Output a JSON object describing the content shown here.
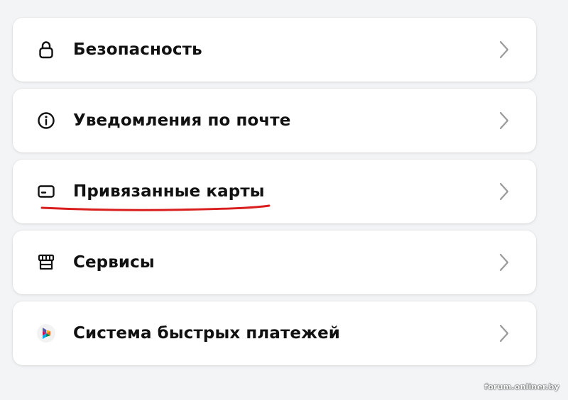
{
  "menu": {
    "items": [
      {
        "label": "Безопасность",
        "icon": "lock-icon"
      },
      {
        "label": "Уведомления по почте",
        "icon": "info-icon"
      },
      {
        "label": "Привязанные карты",
        "icon": "card-icon"
      },
      {
        "label": "Сервисы",
        "icon": "store-icon"
      },
      {
        "label": "Система быстрых платежей",
        "icon": "sbp-logo-icon"
      }
    ]
  },
  "annotation": {
    "underline_color": "#d91c1c"
  },
  "watermark": {
    "text": "forum.onliner.by"
  },
  "colors": {
    "background": "#f3f4f6",
    "card": "#ffffff",
    "text": "#111111",
    "chevron": "#9a9a9a"
  }
}
